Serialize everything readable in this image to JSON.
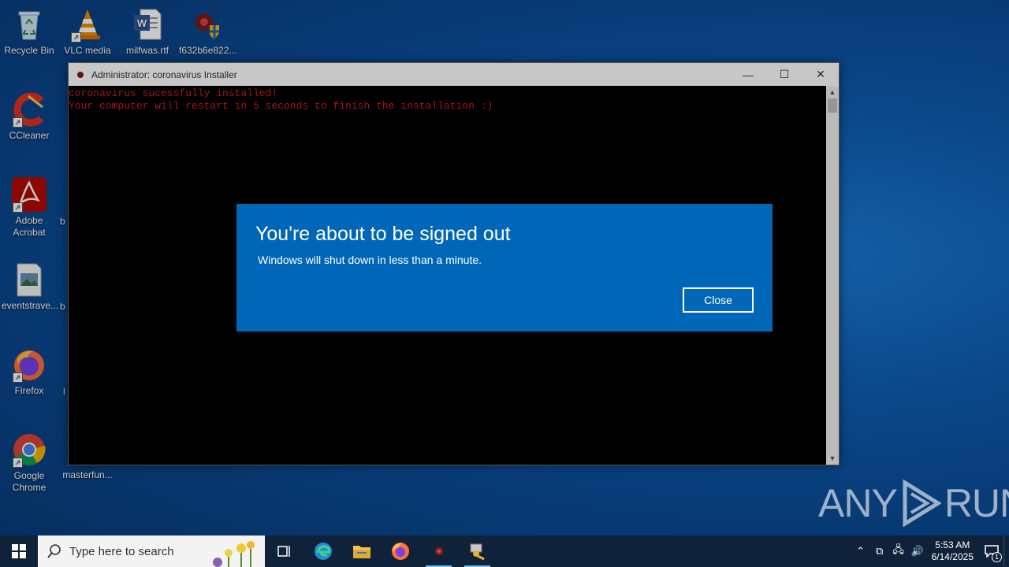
{
  "desktop": {
    "icons": [
      {
        "label": "Recycle Bin"
      },
      {
        "label": "VLC media"
      },
      {
        "label": "milfwas.rtf"
      },
      {
        "label": "f632b6e822..."
      },
      {
        "label": "CCleaner"
      },
      {
        "label": "Adobe Acrobat"
      },
      {
        "label": "eventstrave..."
      },
      {
        "label": "Firefox"
      },
      {
        "label": "Google Chrome"
      },
      {
        "label": "masterfun..."
      }
    ],
    "partial_labels": [
      "b",
      "b",
      "l"
    ]
  },
  "console": {
    "title": "Administrator:  coronavirus Installer",
    "lines": [
      "coronavirus sucessfully installed!",
      "Your computer will restart in 5 seconds to finish the installation :)"
    ],
    "text_color": "#d21c1c"
  },
  "dialog": {
    "title": "You're about to be signed out",
    "message": "Windows will shut down in less than a minute.",
    "close_label": "Close",
    "background": "#0067b8"
  },
  "watermark": {
    "left": "ANY",
    "right": "RUN"
  },
  "taskbar": {
    "search_placeholder": "Type here to search",
    "time": "5:53 AM",
    "date": "6/14/2025",
    "notification_count": "1",
    "apps": [
      "task-view",
      "edge",
      "file-explorer",
      "firefox",
      "console",
      "app-keys"
    ]
  }
}
